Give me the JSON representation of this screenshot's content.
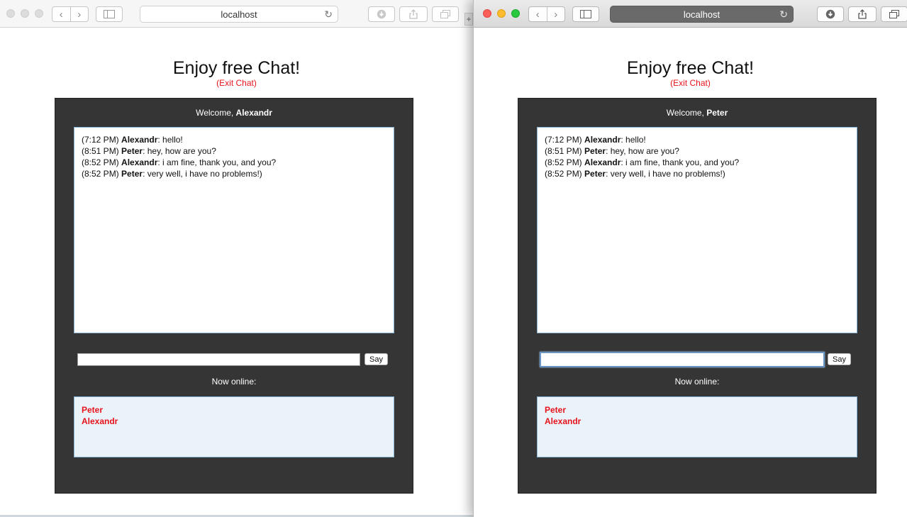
{
  "left_window": {
    "url": "localhost",
    "page": {
      "title": "Enjoy free Chat!",
      "exit_link": "(Exit Chat)",
      "welcome_prefix": "Welcome, ",
      "welcome_user": "Alexandr",
      "messages": [
        {
          "time": "(7:12 PM)",
          "user": "Alexandr",
          "text": ": hello!"
        },
        {
          "time": "(8:51 PM)",
          "user": "Peter",
          "text": ": hey, how are you?"
        },
        {
          "time": "(8:52 PM)",
          "user": "Alexandr",
          "text": ": i am fine, thank you, and you?"
        },
        {
          "time": "(8:52 PM)",
          "user": "Peter",
          "text": ": very well, i have no problems!)"
        }
      ],
      "message_input_value": "",
      "say_button": "Say",
      "online_label": "Now online:",
      "online_users": [
        "Peter",
        "Alexandr"
      ]
    }
  },
  "right_window": {
    "url": "localhost",
    "page": {
      "title": "Enjoy free Chat!",
      "exit_link": "(Exit Chat)",
      "welcome_prefix": "Welcome, ",
      "welcome_user": "Peter",
      "messages": [
        {
          "time": "(7:12 PM)",
          "user": "Alexandr",
          "text": ": hello!"
        },
        {
          "time": "(8:51 PM)",
          "user": "Peter",
          "text": ": hey, how are you?"
        },
        {
          "time": "(8:52 PM)",
          "user": "Alexandr",
          "text": ": i am fine, thank you, and you?"
        },
        {
          "time": "(8:52 PM)",
          "user": "Peter",
          "text": ": very well, i have no problems!)"
        }
      ],
      "message_input_value": "",
      "say_button": "Say",
      "online_label": "Now online:",
      "online_users": [
        "Peter",
        "Alexandr"
      ]
    }
  },
  "icons": {
    "back": "chevron-left-icon",
    "forward": "chevron-right-icon",
    "sidebar": "sidebar-icon",
    "reload": "reload-icon",
    "download": "download-icon",
    "share": "share-icon",
    "tabs": "tabs-overview-icon"
  },
  "colors": {
    "panel_bg": "#353535",
    "accent_red": "#e8121b",
    "online_bg": "#eaf2fa",
    "box_border": "#8ab4d4"
  }
}
